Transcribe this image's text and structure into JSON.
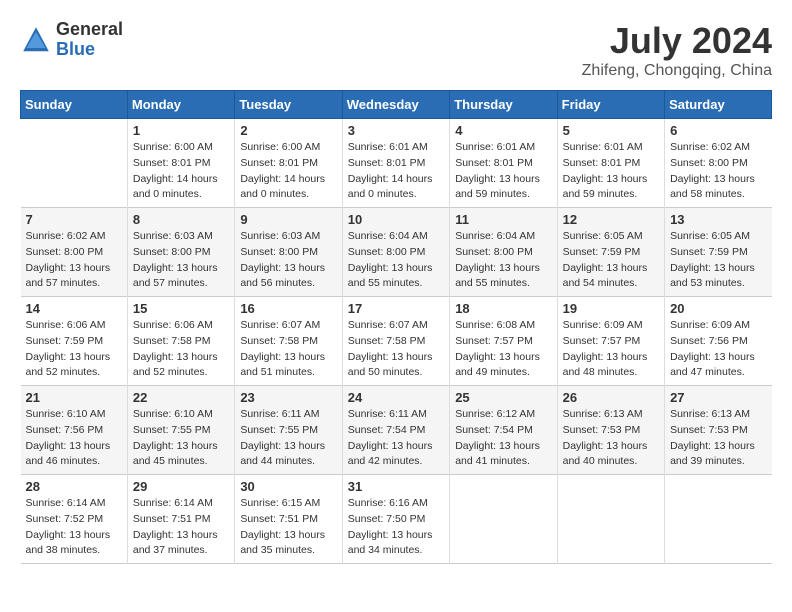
{
  "header": {
    "logo_general": "General",
    "logo_blue": "Blue",
    "month_year": "July 2024",
    "location": "Zhifeng, Chongqing, China"
  },
  "columns": [
    "Sunday",
    "Monday",
    "Tuesday",
    "Wednesday",
    "Thursday",
    "Friday",
    "Saturday"
  ],
  "weeks": [
    [
      {
        "day": "",
        "info": ""
      },
      {
        "day": "1",
        "info": "Sunrise: 6:00 AM\nSunset: 8:01 PM\nDaylight: 14 hours\nand 0 minutes."
      },
      {
        "day": "2",
        "info": "Sunrise: 6:00 AM\nSunset: 8:01 PM\nDaylight: 14 hours\nand 0 minutes."
      },
      {
        "day": "3",
        "info": "Sunrise: 6:01 AM\nSunset: 8:01 PM\nDaylight: 14 hours\nand 0 minutes."
      },
      {
        "day": "4",
        "info": "Sunrise: 6:01 AM\nSunset: 8:01 PM\nDaylight: 13 hours\nand 59 minutes."
      },
      {
        "day": "5",
        "info": "Sunrise: 6:01 AM\nSunset: 8:01 PM\nDaylight: 13 hours\nand 59 minutes."
      },
      {
        "day": "6",
        "info": "Sunrise: 6:02 AM\nSunset: 8:00 PM\nDaylight: 13 hours\nand 58 minutes."
      }
    ],
    [
      {
        "day": "7",
        "info": "Sunrise: 6:02 AM\nSunset: 8:00 PM\nDaylight: 13 hours\nand 57 minutes."
      },
      {
        "day": "8",
        "info": "Sunrise: 6:03 AM\nSunset: 8:00 PM\nDaylight: 13 hours\nand 57 minutes."
      },
      {
        "day": "9",
        "info": "Sunrise: 6:03 AM\nSunset: 8:00 PM\nDaylight: 13 hours\nand 56 minutes."
      },
      {
        "day": "10",
        "info": "Sunrise: 6:04 AM\nSunset: 8:00 PM\nDaylight: 13 hours\nand 55 minutes."
      },
      {
        "day": "11",
        "info": "Sunrise: 6:04 AM\nSunset: 8:00 PM\nDaylight: 13 hours\nand 55 minutes."
      },
      {
        "day": "12",
        "info": "Sunrise: 6:05 AM\nSunset: 7:59 PM\nDaylight: 13 hours\nand 54 minutes."
      },
      {
        "day": "13",
        "info": "Sunrise: 6:05 AM\nSunset: 7:59 PM\nDaylight: 13 hours\nand 53 minutes."
      }
    ],
    [
      {
        "day": "14",
        "info": "Sunrise: 6:06 AM\nSunset: 7:59 PM\nDaylight: 13 hours\nand 52 minutes."
      },
      {
        "day": "15",
        "info": "Sunrise: 6:06 AM\nSunset: 7:58 PM\nDaylight: 13 hours\nand 52 minutes."
      },
      {
        "day": "16",
        "info": "Sunrise: 6:07 AM\nSunset: 7:58 PM\nDaylight: 13 hours\nand 51 minutes."
      },
      {
        "day": "17",
        "info": "Sunrise: 6:07 AM\nSunset: 7:58 PM\nDaylight: 13 hours\nand 50 minutes."
      },
      {
        "day": "18",
        "info": "Sunrise: 6:08 AM\nSunset: 7:57 PM\nDaylight: 13 hours\nand 49 minutes."
      },
      {
        "day": "19",
        "info": "Sunrise: 6:09 AM\nSunset: 7:57 PM\nDaylight: 13 hours\nand 48 minutes."
      },
      {
        "day": "20",
        "info": "Sunrise: 6:09 AM\nSunset: 7:56 PM\nDaylight: 13 hours\nand 47 minutes."
      }
    ],
    [
      {
        "day": "21",
        "info": "Sunrise: 6:10 AM\nSunset: 7:56 PM\nDaylight: 13 hours\nand 46 minutes."
      },
      {
        "day": "22",
        "info": "Sunrise: 6:10 AM\nSunset: 7:55 PM\nDaylight: 13 hours\nand 45 minutes."
      },
      {
        "day": "23",
        "info": "Sunrise: 6:11 AM\nSunset: 7:55 PM\nDaylight: 13 hours\nand 44 minutes."
      },
      {
        "day": "24",
        "info": "Sunrise: 6:11 AM\nSunset: 7:54 PM\nDaylight: 13 hours\nand 42 minutes."
      },
      {
        "day": "25",
        "info": "Sunrise: 6:12 AM\nSunset: 7:54 PM\nDaylight: 13 hours\nand 41 minutes."
      },
      {
        "day": "26",
        "info": "Sunrise: 6:13 AM\nSunset: 7:53 PM\nDaylight: 13 hours\nand 40 minutes."
      },
      {
        "day": "27",
        "info": "Sunrise: 6:13 AM\nSunset: 7:53 PM\nDaylight: 13 hours\nand 39 minutes."
      }
    ],
    [
      {
        "day": "28",
        "info": "Sunrise: 6:14 AM\nSunset: 7:52 PM\nDaylight: 13 hours\nand 38 minutes."
      },
      {
        "day": "29",
        "info": "Sunrise: 6:14 AM\nSunset: 7:51 PM\nDaylight: 13 hours\nand 37 minutes."
      },
      {
        "day": "30",
        "info": "Sunrise: 6:15 AM\nSunset: 7:51 PM\nDaylight: 13 hours\nand 35 minutes."
      },
      {
        "day": "31",
        "info": "Sunrise: 6:16 AM\nSunset: 7:50 PM\nDaylight: 13 hours\nand 34 minutes."
      },
      {
        "day": "",
        "info": ""
      },
      {
        "day": "",
        "info": ""
      },
      {
        "day": "",
        "info": ""
      }
    ]
  ]
}
